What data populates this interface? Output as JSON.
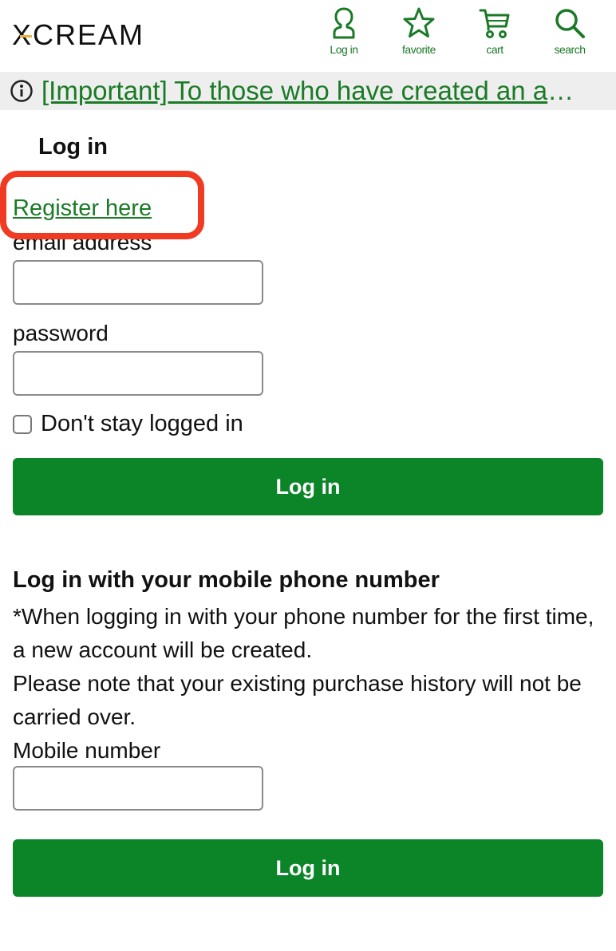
{
  "header": {
    "logo_prefix": "XC",
    "logo_suffix": "REAM",
    "nav": [
      {
        "label": "Log in",
        "icon": "user-icon"
      },
      {
        "label": "favorite",
        "icon": "star-icon"
      },
      {
        "label": "cart",
        "icon": "cart-icon"
      },
      {
        "label": "search",
        "icon": "search-icon"
      }
    ]
  },
  "notice": {
    "icon": "info-icon",
    "text": "[Important] To those who have created an account"
  },
  "login": {
    "title": "Log in",
    "register_link": "Register here",
    "email_label": "email address",
    "email_value": "",
    "password_label": "password",
    "password_value": "",
    "checkbox_label": "Don't stay logged in",
    "checkbox_checked": false,
    "submit_label": "Log in"
  },
  "mobile": {
    "title": "Log in with your mobile phone number",
    "note_line1": "*When logging in with your phone number for the first time, a new account will be created.",
    "note_line2": "Please note that your existing purchase history will not be carried over.",
    "number_label": "Mobile number",
    "number_value": "",
    "submit_label": "Log in"
  },
  "colors": {
    "brand_green": "#0c8528",
    "link_green": "#1a7a26",
    "logo_accent": "#e8b43a",
    "highlight_red": "#f03a22",
    "notice_bg": "#eeeeee"
  }
}
